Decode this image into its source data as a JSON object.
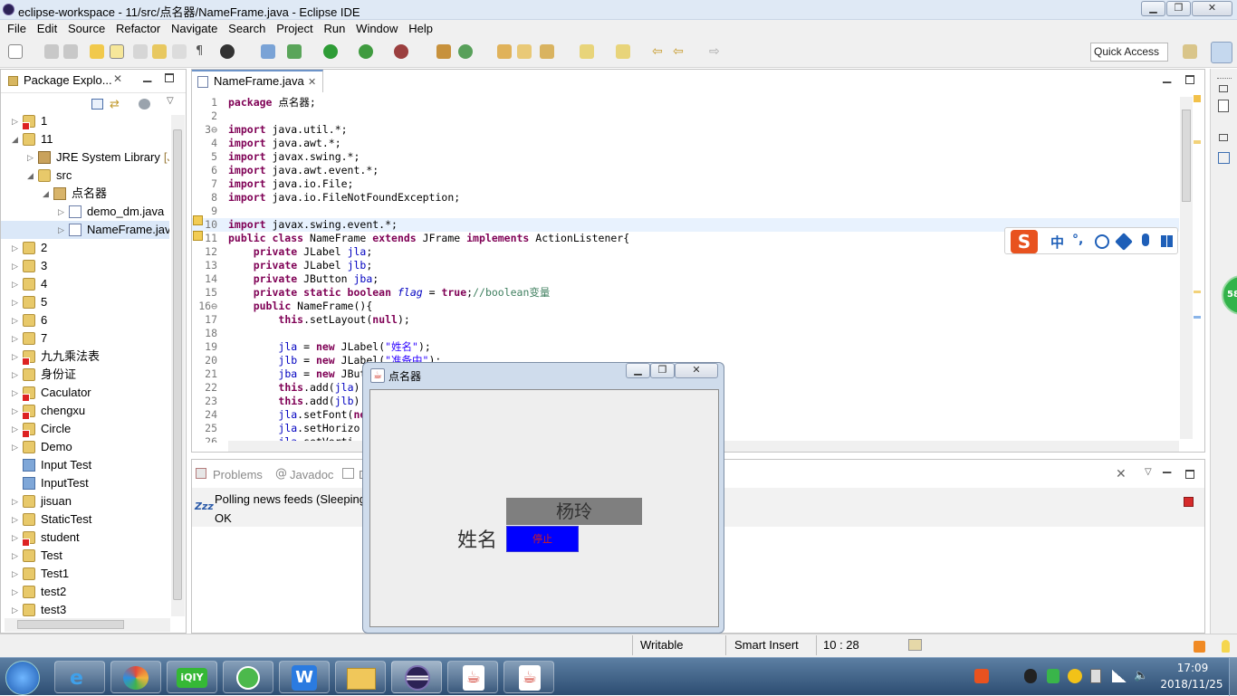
{
  "window": {
    "title": "eclipse-workspace - 11/src/点名器/NameFrame.java - Eclipse IDE"
  },
  "menu": [
    "File",
    "Edit",
    "Source",
    "Refactor",
    "Navigate",
    "Search",
    "Project",
    "Run",
    "Window",
    "Help"
  ],
  "quick_access": "Quick Access",
  "package_explorer": {
    "title": "Package Explo...",
    "items": [
      {
        "label": "1",
        "level": 0,
        "arrow": "▷",
        "icon": "project-error-icon"
      },
      {
        "label": "11",
        "level": 0,
        "arrow": "◢",
        "icon": "project-icon"
      },
      {
        "label": "JRE System Library",
        "suffix": "[Ja",
        "level": 1,
        "arrow": "▷",
        "icon": "library-icon"
      },
      {
        "label": "src",
        "level": 1,
        "arrow": "◢",
        "icon": "source-folder-icon"
      },
      {
        "label": "点名器",
        "level": 2,
        "arrow": "◢",
        "icon": "package-icon"
      },
      {
        "label": "demo_dm.java",
        "level": 3,
        "arrow": "▷",
        "icon": "java-file-icon"
      },
      {
        "label": "NameFrame.java",
        "level": 3,
        "arrow": "▷",
        "icon": "java-file-icon",
        "selected": true
      },
      {
        "label": "2",
        "level": 0,
        "arrow": "▷",
        "icon": "project-icon"
      },
      {
        "label": "3",
        "level": 0,
        "arrow": "▷",
        "icon": "project-icon"
      },
      {
        "label": "4",
        "level": 0,
        "arrow": "▷",
        "icon": "project-icon"
      },
      {
        "label": "5",
        "level": 0,
        "arrow": "▷",
        "icon": "project-icon"
      },
      {
        "label": "6",
        "level": 0,
        "arrow": "▷",
        "icon": "project-icon"
      },
      {
        "label": "7",
        "level": 0,
        "arrow": "▷",
        "icon": "project-icon"
      },
      {
        "label": "九九乘法表",
        "level": 0,
        "arrow": "▷",
        "icon": "project-error-icon"
      },
      {
        "label": "身份证",
        "level": 0,
        "arrow": "▷",
        "icon": "project-icon"
      },
      {
        "label": "Caculator",
        "level": 0,
        "arrow": "▷",
        "icon": "project-error-icon"
      },
      {
        "label": "chengxu",
        "level": 0,
        "arrow": "▷",
        "icon": "project-error-icon"
      },
      {
        "label": "Circle",
        "level": 0,
        "arrow": "▷",
        "icon": "project-error-icon"
      },
      {
        "label": "Demo",
        "level": 0,
        "arrow": "▷",
        "icon": "project-icon"
      },
      {
        "label": "Input Test",
        "level": 0,
        "arrow": "",
        "icon": "folder-icon"
      },
      {
        "label": "InputTest",
        "level": 0,
        "arrow": "",
        "icon": "folder-icon"
      },
      {
        "label": "jisuan",
        "level": 0,
        "arrow": "▷",
        "icon": "project-icon"
      },
      {
        "label": "StaticTest",
        "level": 0,
        "arrow": "▷",
        "icon": "project-icon"
      },
      {
        "label": "student",
        "level": 0,
        "arrow": "▷",
        "icon": "project-error-icon"
      },
      {
        "label": "Test",
        "level": 0,
        "arrow": "▷",
        "icon": "project-icon"
      },
      {
        "label": "Test1",
        "level": 0,
        "arrow": "▷",
        "icon": "project-icon"
      },
      {
        "label": "test2",
        "level": 0,
        "arrow": "▷",
        "icon": "project-icon"
      },
      {
        "label": "test3",
        "level": 0,
        "arrow": "▷",
        "icon": "project-icon"
      }
    ]
  },
  "editor": {
    "tab": "NameFrame.java",
    "lines": [
      {
        "n": "1",
        "html": "<span class='kw'>package</span> 点名器;"
      },
      {
        "n": "2",
        "html": ""
      },
      {
        "n": "3⊖",
        "html": "<span class='kw'>import</span> java.util.*;"
      },
      {
        "n": "4",
        "html": "<span class='kw'>import</span> java.awt.*;"
      },
      {
        "n": "5",
        "html": "<span class='kw'>import</span> javax.swing.*;"
      },
      {
        "n": "6",
        "html": "<span class='kw'>import</span> java.awt.event.*;"
      },
      {
        "n": "7",
        "html": "<span class='kw'>import</span> java.io.File;"
      },
      {
        "n": "8",
        "html": "<span class='kw'>import</span> java.io.FileNotFoundException;"
      },
      {
        "n": "9",
        "html": ""
      },
      {
        "n": "10",
        "html": "<span class='kw'>import</span> javax.swing.event.*;",
        "current": true
      },
      {
        "n": "11",
        "html": "<span class='kw'>public class</span> NameFrame <span class='kw'>extends</span> JFrame <span class='kw'>implements</span> ActionListener{"
      },
      {
        "n": "12",
        "html": "    <span class='kw'>private</span> JLabel <span class='fld'>jla</span>;"
      },
      {
        "n": "13",
        "html": "    <span class='kw'>private</span> JLabel <span class='fld'>jlb</span>;"
      },
      {
        "n": "14",
        "html": "    <span class='kw'>private</span> JButton <span class='fld'>jba</span>;"
      },
      {
        "n": "15",
        "html": "    <span class='kw'>private static boolean</span> <span class='fld it'>flag</span> = <span class='kw'>true</span>;<span class='cm'>//boolean变量</span>"
      },
      {
        "n": "16⊖",
        "html": "    <span class='kw'>public</span> NameFrame(){"
      },
      {
        "n": "17",
        "html": "        <span class='kw'>this</span>.setLayout(<span class='kw'>null</span>);"
      },
      {
        "n": "18",
        "html": ""
      },
      {
        "n": "19",
        "html": "        <span class='fld'>jla</span> = <span class='kw'>new</span> JLabel(<span class='str'>\"姓名\"</span>);"
      },
      {
        "n": "20",
        "html": "        <span class='fld'>jlb</span> = <span class='kw'>new</span> JLabel(<span class='str'>\"准备中\"</span>);"
      },
      {
        "n": "21",
        "html": "        <span class='fld'>jba</span> = <span class='kw'>new</span> JBut"
      },
      {
        "n": "22",
        "html": "        <span class='kw'>this</span>.add(<span class='fld'>jla</span>)"
      },
      {
        "n": "23",
        "html": "        <span class='kw'>this</span>.add(<span class='fld'>jlb</span>)"
      },
      {
        "n": "24",
        "html": "        <span class='fld'>jla</span>.setFont(<span class='kw'>ne</span>"
      },
      {
        "n": "25",
        "html": "        <span class='fld'>jla</span>.setHorizo"
      },
      {
        "n": "26",
        "html": "        <span class='fld'>jla</span>.setVerti"
      }
    ]
  },
  "bottom_panel": {
    "tabs": [
      "Problems",
      "Javadoc",
      "D"
    ],
    "status_line1": "Polling news feeds (Sleeping",
    "status_line2": "OK"
  },
  "statusbar": {
    "writable": "Writable",
    "insert_mode": "Smart Insert",
    "position": "10 : 28"
  },
  "dialog": {
    "title": "点名器",
    "name_label": "姓名",
    "name_value": "杨玲",
    "stop_button": "停止"
  },
  "ime_bar": {
    "mode": "中",
    "punct": "°,"
  },
  "taskbar": {
    "time": "17:09",
    "date": "2018/11/25"
  },
  "side_badge": "58",
  "colors": {
    "dialog_value_bg": "#7f7f7f",
    "stop_button_bg": "#0000ff",
    "stop_text": "#d21e1e",
    "keyword": "#7f0055",
    "string": "#2a00ff"
  }
}
